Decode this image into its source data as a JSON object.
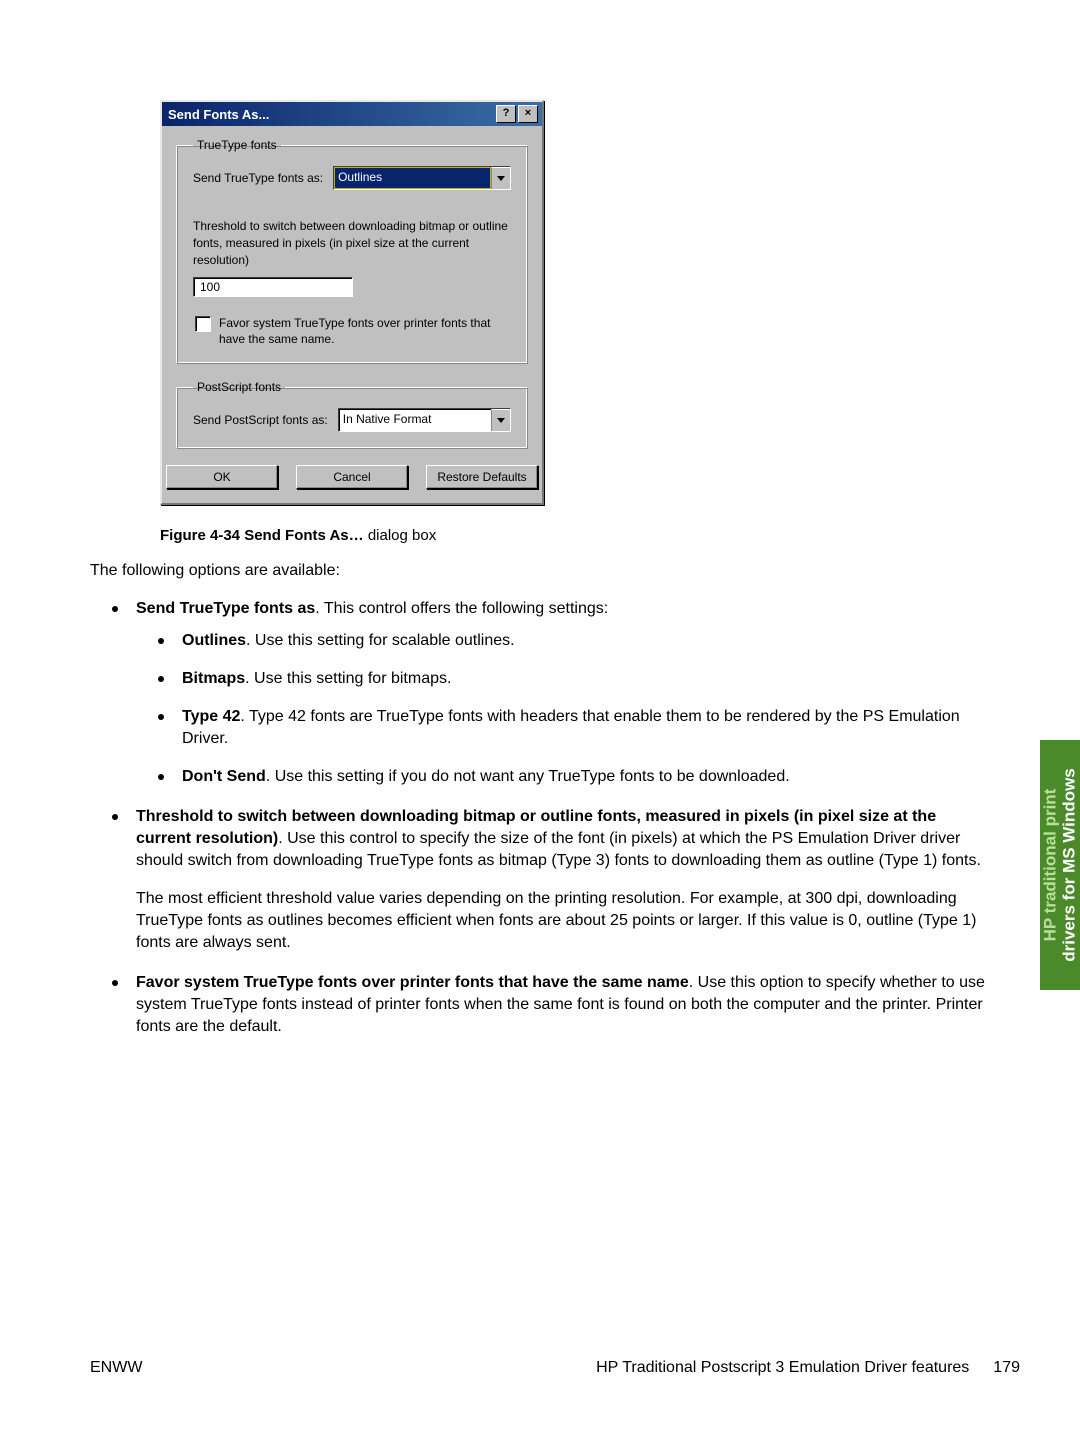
{
  "dialog": {
    "title": "Send Fonts As...",
    "help_btn": "?",
    "close_btn": "×",
    "group_truetype": {
      "legend": "TrueType fonts",
      "send_label": "Send TrueType fonts as:",
      "send_value": "Outlines",
      "threshold_text": "Threshold to switch between downloading bitmap or outline fonts, measured in pixels (in pixel size at the current resolution)",
      "threshold_value": "100",
      "favor_label": "Favor system TrueType fonts over printer fonts that have the same name."
    },
    "group_postscript": {
      "legend": "PostScript fonts",
      "send_label": "Send PostScript fonts as:",
      "send_value": "In Native Format"
    },
    "buttons": {
      "ok": "OK",
      "cancel": "Cancel",
      "restore": "Restore Defaults"
    }
  },
  "caption": {
    "fig": "Figure 4-34",
    "title": "  Send Fonts As…",
    "rest": " dialog box"
  },
  "intro": "The following options are available:",
  "bullets": {
    "b1_bold": "Send TrueType fonts as",
    "b1_rest": ". This control offers the following settings:",
    "s1_bold": "Outlines",
    "s1_rest": ". Use this setting for scalable outlines.",
    "s2_bold": "Bitmaps",
    "s2_rest": ". Use this setting for bitmaps.",
    "s3_bold": "Type 42",
    "s3_rest": ". Type 42 fonts are TrueType fonts with headers that enable them to be rendered by the PS Emulation Driver.",
    "s4_bold": "Don't Send",
    "s4_rest": ". Use this setting if you do not want any TrueType fonts to be downloaded.",
    "b2_bold": "Threshold to switch between downloading bitmap or outline fonts, measured in pixels (in pixel size at the current resolution)",
    "b2_rest": ". Use this control to specify the size of the font (in pixels) at which the PS Emulation Driver driver should switch from downloading TrueType fonts as bitmap (Type 3) fonts to downloading them as outline (Type 1) fonts.",
    "b2_para2": "The most efficient threshold value varies depending on the printing resolution. For example, at 300 dpi, downloading TrueType fonts as outlines becomes efficient when fonts are about 25 points or larger. If this value is 0, outline (Type 1) fonts are always sent.",
    "b3_bold": "Favor system TrueType fonts over printer fonts that have the same name",
    "b3_rest": ". Use this option to specify whether to use system TrueType fonts instead of printer fonts when the same font is found on both the computer and the printer. Printer fonts are the default."
  },
  "side_tab": {
    "line1": "HP traditional print",
    "line2": "drivers for MS Windows"
  },
  "footer": {
    "left": "ENWW",
    "center": "HP Traditional Postscript 3 Emulation Driver features",
    "page": "179"
  }
}
